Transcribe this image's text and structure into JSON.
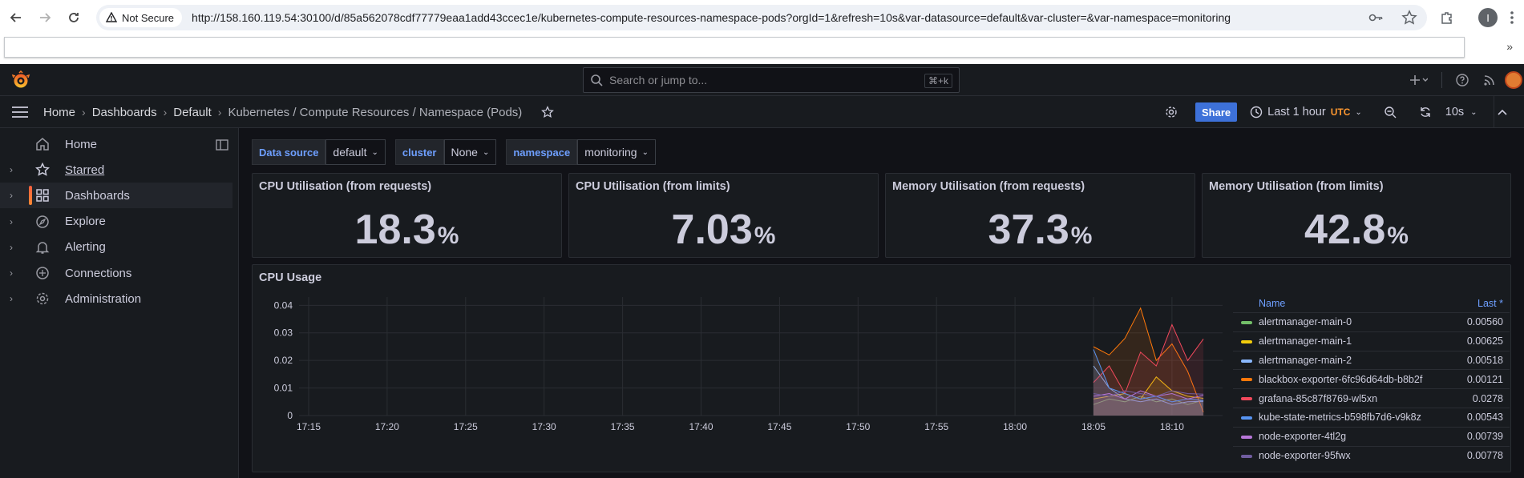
{
  "browser": {
    "security_label": "Not Secure",
    "url": "http://158.160.119.54:30100/d/85a562078cdf77779eaa1add43ccec1e/kubernetes-compute-resources-namespace-pods?orgId=1&refresh=10s&var-datasource=default&var-cluster=&var-namespace=monitoring",
    "profile_initial": "I"
  },
  "topnav": {
    "search_placeholder": "Search or jump to...",
    "search_shortcut": "⌘+k"
  },
  "breadcrumb": [
    "Home",
    "Dashboards",
    "Default",
    "Kubernetes / Compute Resources / Namespace (Pods)"
  ],
  "toolbar": {
    "share_label": "Share",
    "time_range": "Last 1 hour",
    "timezone": "UTC",
    "refresh_interval": "10s"
  },
  "sidebar": {
    "items": [
      {
        "label": "Home",
        "icon": "home-icon",
        "expandable": false,
        "active": false
      },
      {
        "label": "Starred",
        "icon": "star-icon",
        "expandable": true,
        "active": false
      },
      {
        "label": "Dashboards",
        "icon": "apps-icon",
        "expandable": true,
        "active": true
      },
      {
        "label": "Explore",
        "icon": "compass-icon",
        "expandable": true,
        "active": false
      },
      {
        "label": "Alerting",
        "icon": "bell-icon",
        "expandable": true,
        "active": false
      },
      {
        "label": "Connections",
        "icon": "connections-icon",
        "expandable": true,
        "active": false
      },
      {
        "label": "Administration",
        "icon": "cog-icon",
        "expandable": true,
        "active": false
      }
    ]
  },
  "variables": {
    "datasource": {
      "label": "Data source",
      "value": "default"
    },
    "cluster": {
      "label": "cluster",
      "value": "None"
    },
    "namespace": {
      "label": "namespace",
      "value": "monitoring"
    }
  },
  "stats": [
    {
      "title": "CPU Utilisation (from requests)",
      "value": "18.3",
      "unit": "%"
    },
    {
      "title": "CPU Utilisation (from limits)",
      "value": "7.03",
      "unit": "%"
    },
    {
      "title": "Memory Utilisation (from requests)",
      "value": "37.3",
      "unit": "%"
    },
    {
      "title": "Memory Utilisation (from limits)",
      "value": "42.8",
      "unit": "%"
    }
  ],
  "graph": {
    "title": "CPU Usage",
    "legend_name_header": "Name",
    "legend_value_header": "Last *"
  },
  "chart_data": {
    "type": "line",
    "title": "CPU Usage",
    "x_ticks": [
      "17:15",
      "17:20",
      "17:25",
      "17:30",
      "17:35",
      "17:40",
      "17:45",
      "17:50",
      "17:55",
      "18:00",
      "18:05",
      "18:10"
    ],
    "y_ticks": [
      "0",
      "0.01",
      "0.02",
      "0.03",
      "0.04"
    ],
    "ylim": [
      0,
      0.043
    ],
    "x": [
      "18:05",
      "18:06",
      "18:07",
      "18:08",
      "18:09",
      "18:10",
      "18:11",
      "18:12"
    ],
    "series": [
      {
        "name": "alertmanager-main-0",
        "color": "#73bf69",
        "values": [
          0.004,
          0.006,
          0.005,
          0.007,
          0.005,
          0.006,
          0.004,
          0.0056
        ],
        "last": "0.00560"
      },
      {
        "name": "alertmanager-main-1",
        "color": "#f2cc0c",
        "values": [
          0.006,
          0.007,
          0.008,
          0.006,
          0.014,
          0.009,
          0.007,
          0.00625
        ],
        "last": "0.00625"
      },
      {
        "name": "alertmanager-main-2",
        "color": "#8ab8ff",
        "values": [
          0.018,
          0.01,
          0.006,
          0.005,
          0.006,
          0.004,
          0.005,
          0.00518
        ],
        "last": "0.00518"
      },
      {
        "name": "blackbox-exporter-6fc96d64db-b8b2f",
        "color": "#ff780a",
        "values": [
          0.025,
          0.022,
          0.028,
          0.039,
          0.02,
          0.026,
          0.016,
          0.00121
        ],
        "last": "0.00121"
      },
      {
        "name": "grafana-85c87f8769-wl5xn",
        "color": "#f2495c",
        "values": [
          0.012,
          0.018,
          0.008,
          0.023,
          0.018,
          0.033,
          0.02,
          0.0278
        ],
        "last": "0.0278"
      },
      {
        "name": "kube-state-metrics-b598fb7d6-v9k8z",
        "color": "#5794f2",
        "values": [
          0.024,
          0.01,
          0.008,
          0.006,
          0.007,
          0.005,
          0.006,
          0.00543
        ],
        "last": "0.00543"
      },
      {
        "name": "node-exporter-4tl2g",
        "color": "#b877d9",
        "values": [
          0.007,
          0.008,
          0.006,
          0.009,
          0.007,
          0.008,
          0.006,
          0.00739
        ],
        "last": "0.00739"
      },
      {
        "name": "node-exporter-95fwx",
        "color": "#705da0",
        "values": [
          0.008,
          0.007,
          0.009,
          0.008,
          0.007,
          0.009,
          0.008,
          0.00778
        ],
        "last": "0.00778"
      }
    ]
  }
}
